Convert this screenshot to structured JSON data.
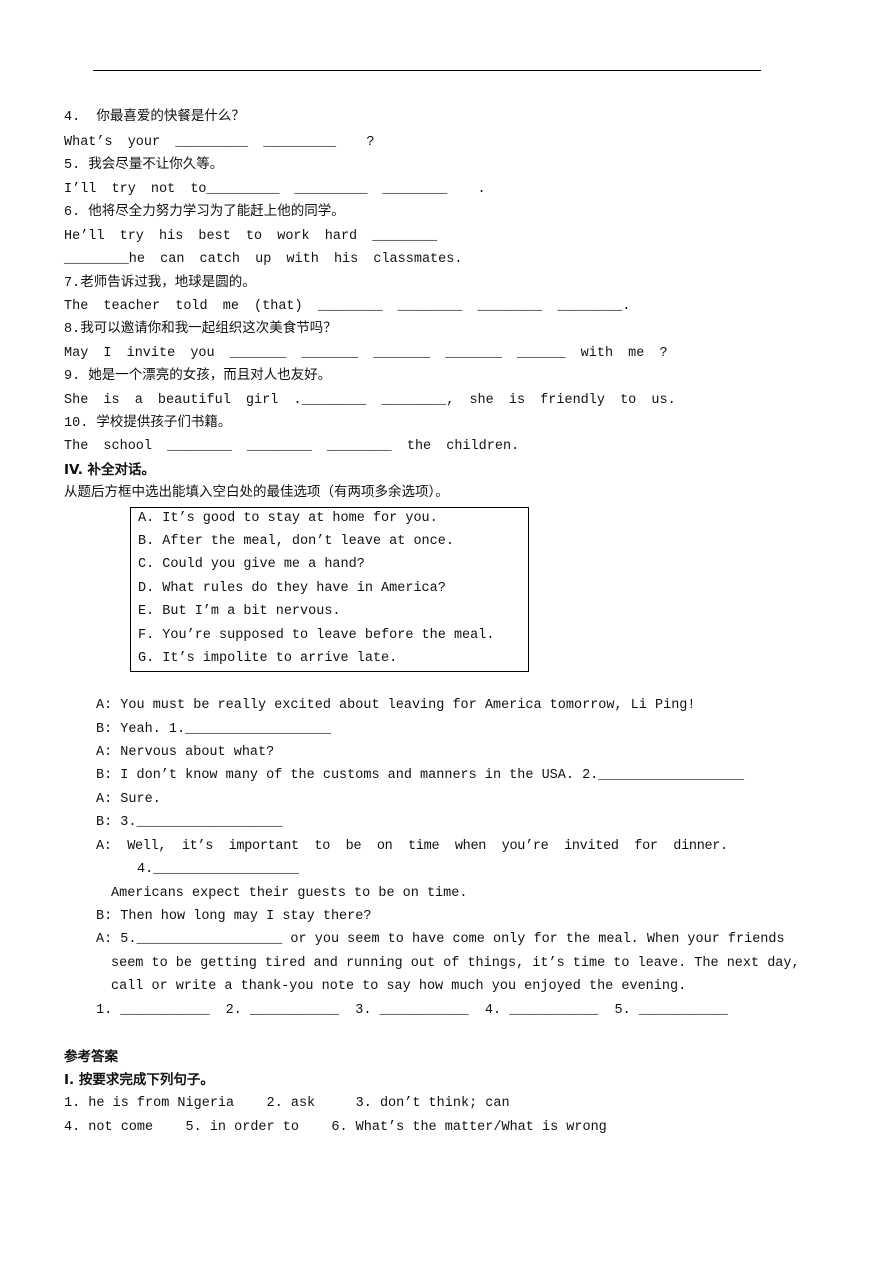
{
  "questions": [
    {
      "cn": "4.  你最喜爱的快餐是什么？",
      "en": "What’s your _________ _________  ?"
    },
    {
      "cn": "5. 我会尽量不让你久等。",
      "en": "I’ll try not to_________ _________ ________  ."
    },
    {
      "cn": "6. 他将尽全力努力学习为了能赶上他的同学。",
      "en": "He’ll try his best to work hard ________",
      "en2": "________he can catch up with his classmates."
    },
    {
      "cn": "7.老师告诉过我，地球是圆的。",
      "en": "The teacher told me (that) ________ ________ ________ ________."
    },
    {
      "cn": "8.我可以邀请你和我一起组织这次美食节吗？",
      "en": "May I invite you _______ _______ _______ _______ ______ with me ?"
    },
    {
      "cn": "9. 她是一个漂亮的女孩，而且对人也友好。",
      "en": "She is a beautiful girl .________ ________, she is friendly to us."
    },
    {
      "cn": "10. 学校提供孩子们书籍。",
      "en": "The school ________ ________ ________ the children."
    }
  ],
  "section4": {
    "title": "IV. 补全对话。",
    "instruction": "从题后方框中选出能填入空白处的最佳选项（有两项多余选项）。",
    "options": [
      "A. It’s good to stay at home for you.",
      "B. After the meal, don’t leave at once.",
      "C. Could you give me a hand?",
      "D. What rules do they have in America?",
      "E. But I’m a bit nervous.",
      "F. You’re supposed to leave before the meal.",
      "G. It’s impolite to arrive late."
    ],
    "dialog": [
      "A: You must be really excited about leaving for America tomorrow, Li Ping!",
      "B: Yeah. 1.__________________",
      "A: Nervous about what?",
      "B: I don’t know many of the customs and manners in the USA. 2.__________________",
      "A: Sure.",
      "B: 3.__________________",
      "A:  Well,  it’s  important  to  be  on  time  when  you’re  invited  for  dinner.",
      "4.__________________",
      "Americans expect their guests to be on time.",
      "B: Then how long may I stay there?",
      "A: 5.__________________ or you seem to have come only for the meal. When your friends",
      "seem to be getting tired and running out of things, it’s time to leave. The next day,",
      "call or write a thank-you note to say how much you enjoyed the evening."
    ],
    "answer_line": "1. ___________  2. ___________  3. ___________  4. ___________  5. ___________"
  },
  "answers": {
    "title": "参考答案",
    "section1_title": "I. 按要求完成下列句子。",
    "line1": "1. he is from Nigeria    2. ask     3. don’t think; can",
    "line2": "4. not come    5. in order to    6. What’s the matter/What is wrong"
  }
}
